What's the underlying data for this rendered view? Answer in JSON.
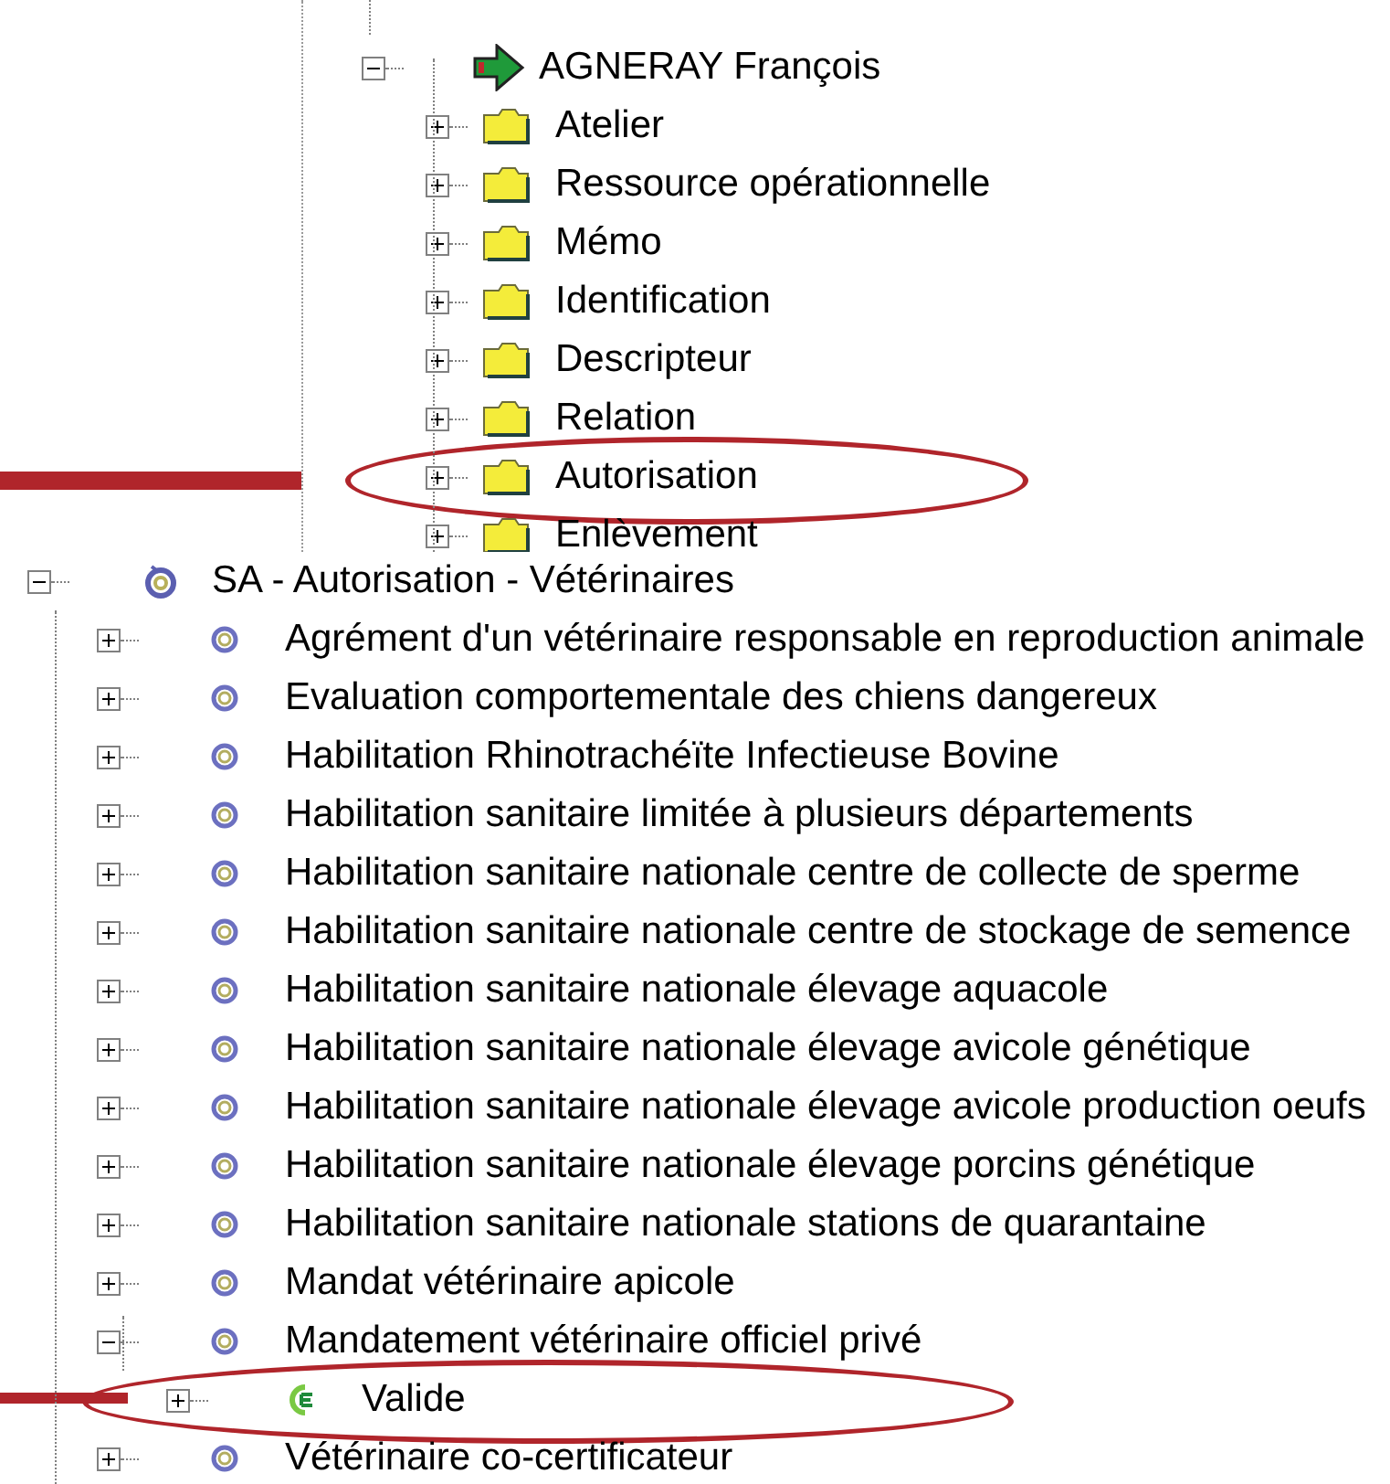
{
  "upper_tree": {
    "nodes": [
      {
        "label": "AGNERAY François",
        "kind": "person",
        "expanded": true,
        "highlighted": false,
        "children": [
          {
            "label": "Atelier",
            "kind": "folder",
            "expanded": false,
            "highlighted": false
          },
          {
            "label": "Ressource opérationnelle",
            "kind": "folder",
            "expanded": false,
            "highlighted": false
          },
          {
            "label": "Mémo",
            "kind": "folder",
            "expanded": false,
            "highlighted": false
          },
          {
            "label": "Identification",
            "kind": "folder",
            "expanded": false,
            "highlighted": false
          },
          {
            "label": "Descripteur",
            "kind": "folder",
            "expanded": false,
            "highlighted": false
          },
          {
            "label": "Relation",
            "kind": "folder",
            "expanded": false,
            "highlighted": false
          },
          {
            "label": "Autorisation",
            "kind": "folder",
            "expanded": false,
            "highlighted": true
          },
          {
            "label": "Enlèvement",
            "kind": "folder",
            "expanded": false,
            "highlighted": false
          }
        ]
      }
    ]
  },
  "lower_tree": {
    "nodes": [
      {
        "label": "SA - Autorisation - Vétérinaires",
        "kind": "group",
        "expanded": true,
        "highlighted": false,
        "children": [
          {
            "label": "Agrément d'un vétérinaire responsable en reproduction animale",
            "kind": "authorization",
            "expanded": false,
            "highlighted": false
          },
          {
            "label": "Evaluation comportementale des chiens dangereux",
            "kind": "authorization",
            "expanded": false,
            "highlighted": false
          },
          {
            "label": "Habilitation Rhinotrachéïte Infectieuse Bovine",
            "kind": "authorization",
            "expanded": false,
            "highlighted": false
          },
          {
            "label": "Habilitation sanitaire limitée à plusieurs départements",
            "kind": "authorization",
            "expanded": false,
            "highlighted": false
          },
          {
            "label": "Habilitation sanitaire nationale centre de collecte de sperme",
            "kind": "authorization",
            "expanded": false,
            "highlighted": false
          },
          {
            "label": "Habilitation sanitaire nationale centre de stockage de semence",
            "kind": "authorization",
            "expanded": false,
            "highlighted": false
          },
          {
            "label": "Habilitation sanitaire nationale élevage aquacole",
            "kind": "authorization",
            "expanded": false,
            "highlighted": false
          },
          {
            "label": "Habilitation sanitaire nationale élevage avicole génétique",
            "kind": "authorization",
            "expanded": false,
            "highlighted": false
          },
          {
            "label": "Habilitation sanitaire nationale élevage avicole production oeufs",
            "kind": "authorization",
            "expanded": false,
            "highlighted": false
          },
          {
            "label": "Habilitation sanitaire nationale élevage porcins génétique",
            "kind": "authorization",
            "expanded": false,
            "highlighted": false
          },
          {
            "label": "Habilitation sanitaire nationale stations de quarantaine",
            "kind": "authorization",
            "expanded": false,
            "highlighted": false
          },
          {
            "label": "Mandat vétérinaire apicole",
            "kind": "authorization",
            "expanded": false,
            "highlighted": false
          },
          {
            "label": "Mandatement vétérinaire officiel privé",
            "kind": "authorization",
            "expanded": true,
            "highlighted": false,
            "children": [
              {
                "label": "Valide",
                "kind": "status",
                "expanded": false,
                "highlighted": true
              }
            ]
          },
          {
            "label": "Vétérinaire co-certificateur",
            "kind": "authorization",
            "expanded": false,
            "highlighted": false
          }
        ]
      }
    ]
  }
}
